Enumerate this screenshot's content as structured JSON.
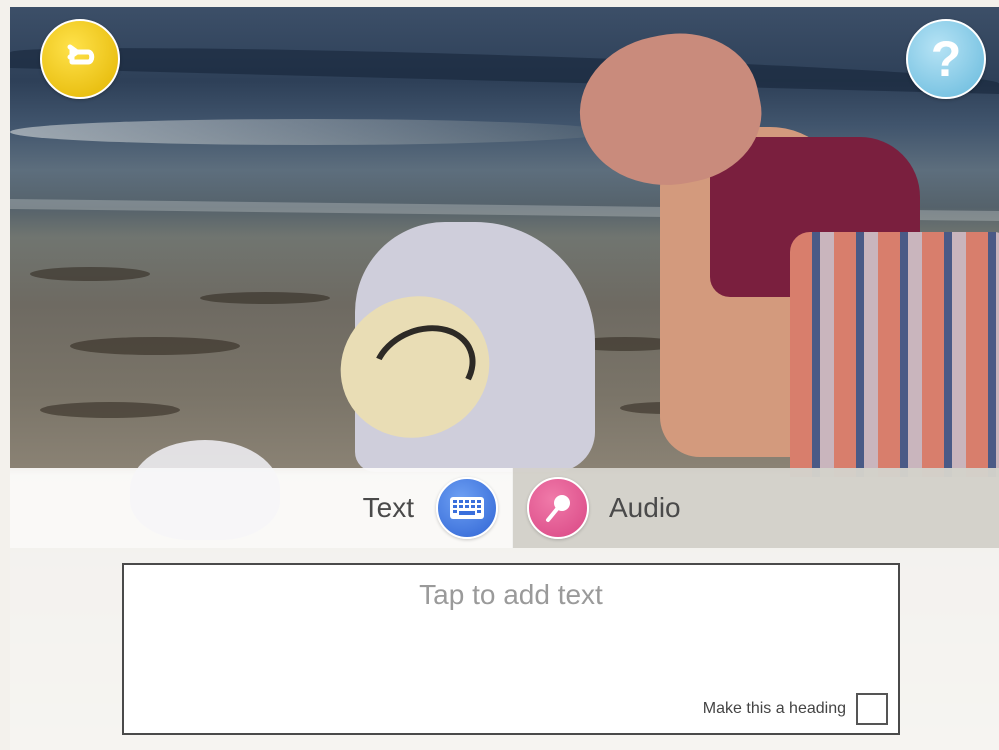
{
  "toolbar": {
    "back_icon": "back-arrow-icon",
    "help_icon": "help-icon",
    "help_glyph": "?"
  },
  "tabs": {
    "text_label": "Text",
    "text_icon": "keyboard-icon",
    "audio_label": "Audio",
    "audio_icon": "microphone-icon"
  },
  "editor": {
    "placeholder": "Tap to add text",
    "heading_label": "Make this a heading",
    "heading_checked": false
  },
  "colors": {
    "back_button": "#f0c419",
    "help_button": "#7ec6e3",
    "keyboard_button": "#3a6fdc",
    "microphone_button": "#e0528f"
  }
}
